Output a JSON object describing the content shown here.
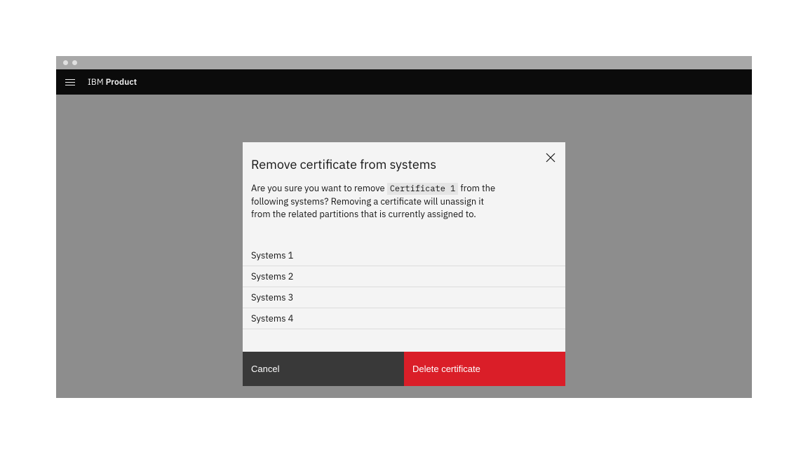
{
  "header": {
    "brand_ibm": "IBM",
    "brand_product": "Product"
  },
  "modal": {
    "title": "Remove certificate from systems",
    "desc_before": "Are you sure you want to remove ",
    "cert_name": "Certificate 1",
    "desc_after": " from the following systems? Removing a certificate will unassign it from the related partitions that is currently assigned to.",
    "systems": [
      "Systems 1",
      "Systems 2",
      "Systems 3",
      "Systems 4"
    ],
    "cancel_label": "Cancel",
    "delete_label": "Delete certificate"
  }
}
